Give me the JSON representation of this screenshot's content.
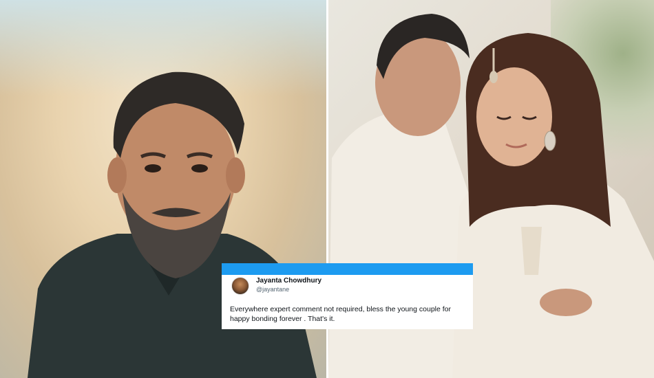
{
  "tweet": {
    "name": "Jayanta Chowdhury",
    "handle": "@jayantane",
    "text": "Everywhere expert comment not required, bless the young couple for happy bonding forever . That's it."
  },
  "colors": {
    "card_header": "#1d9bf0",
    "card_background": "#ffffff"
  }
}
